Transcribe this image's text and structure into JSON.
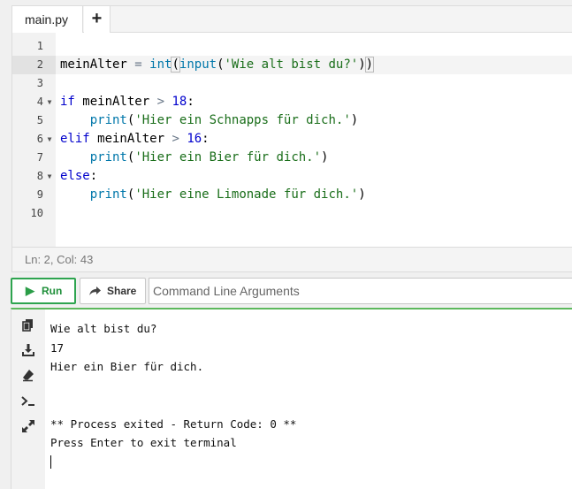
{
  "editor": {
    "tabs": [
      {
        "label": "main.py"
      }
    ],
    "add_tab_label": "+",
    "line_numbers": [
      "1",
      "2",
      "3",
      "4",
      "5",
      "6",
      "7",
      "8",
      "9",
      "10"
    ],
    "lines": [
      "",
      "meinAlter = int(input('Wie alt bist du?'))",
      "",
      "if meinAlter > 18:",
      "    print('Hier ein Schnapps für dich.')",
      "elif meinAlter > 16:",
      "    print('Hier ein Bier für dich.')",
      "else:",
      "    print('Hier eine Limonade für dich.')",
      ""
    ],
    "status": "Ln: 2,  Col: 43"
  },
  "toolbar": {
    "run_label": "Run",
    "share_label": "Share",
    "args_placeholder": "Command Line Arguments"
  },
  "terminal": {
    "lines": [
      "Wie alt bist du?",
      "17",
      "Hier ein Bier für dich.",
      "",
      "",
      "** Process exited - Return Code: 0 **",
      "Press Enter to exit terminal"
    ],
    "tools": [
      "copy-icon",
      "download-icon",
      "eraser-icon",
      "terminal-icon",
      "expand-icon"
    ]
  },
  "colors": {
    "run_green": "#2ea44f",
    "keyword_blue": "#0000cc",
    "string_green": "#1a6e1a"
  }
}
